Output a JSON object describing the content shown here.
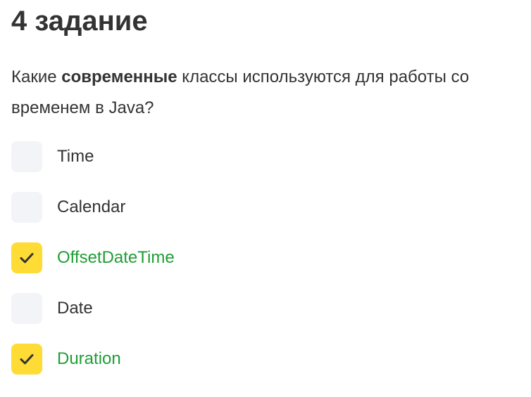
{
  "task": {
    "title": "4 задание",
    "question_before": "Какие ",
    "question_bold": "современные",
    "question_after": " классы используются для работы со временем в Java?"
  },
  "options": [
    {
      "label": "Time",
      "checked": false
    },
    {
      "label": "Calendar",
      "checked": false
    },
    {
      "label": "OffsetDateTime",
      "checked": true
    },
    {
      "label": "Date",
      "checked": false
    },
    {
      "label": "Duration",
      "checked": true
    }
  ],
  "colors": {
    "checkbox_checked": "#ffdc35",
    "checkbox_unchecked": "#f3f4f8",
    "correct_label": "#1f9e34",
    "text": "#333333",
    "checkmark": "#333333"
  },
  "icons": {
    "checkmark": "checkmark-icon"
  }
}
